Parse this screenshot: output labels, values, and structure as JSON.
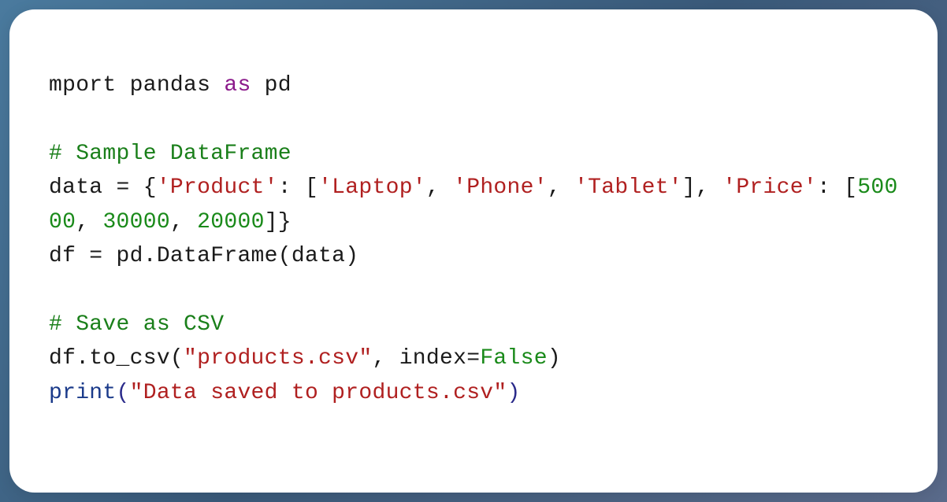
{
  "code": {
    "line1": {
      "t1": "mport pandas ",
      "kw_as": "as",
      "t2": " pd"
    },
    "blank1": "",
    "line3": {
      "comment": "# Sample DataFrame"
    },
    "line4": {
      "t1": "data = {",
      "s1": "'Product'",
      "t2": ": [",
      "s2": "'Laptop'",
      "t3": ", ",
      "s3": "'Phone'",
      "t4": ", ",
      "s4": "'Tablet'",
      "t5": "], ",
      "s5": "'Price'",
      "t6": ": [",
      "n1": "50000",
      "t7": ", ",
      "n2": "30000",
      "t8": ", ",
      "n3": "20000",
      "t9": "]}"
    },
    "line5": {
      "t1": "df = pd.DataFrame(data)"
    },
    "blank2": "",
    "line7": {
      "comment": "# Save as CSV"
    },
    "line8": {
      "t1": "df.to_csv(",
      "s1": "\"products.csv\"",
      "t2": ", index=",
      "b1": "False",
      "t3": ")"
    },
    "line9": {
      "fn": "print",
      "p1": "(",
      "s1": "\"Data saved to products.csv\"",
      "p2": ")"
    }
  }
}
